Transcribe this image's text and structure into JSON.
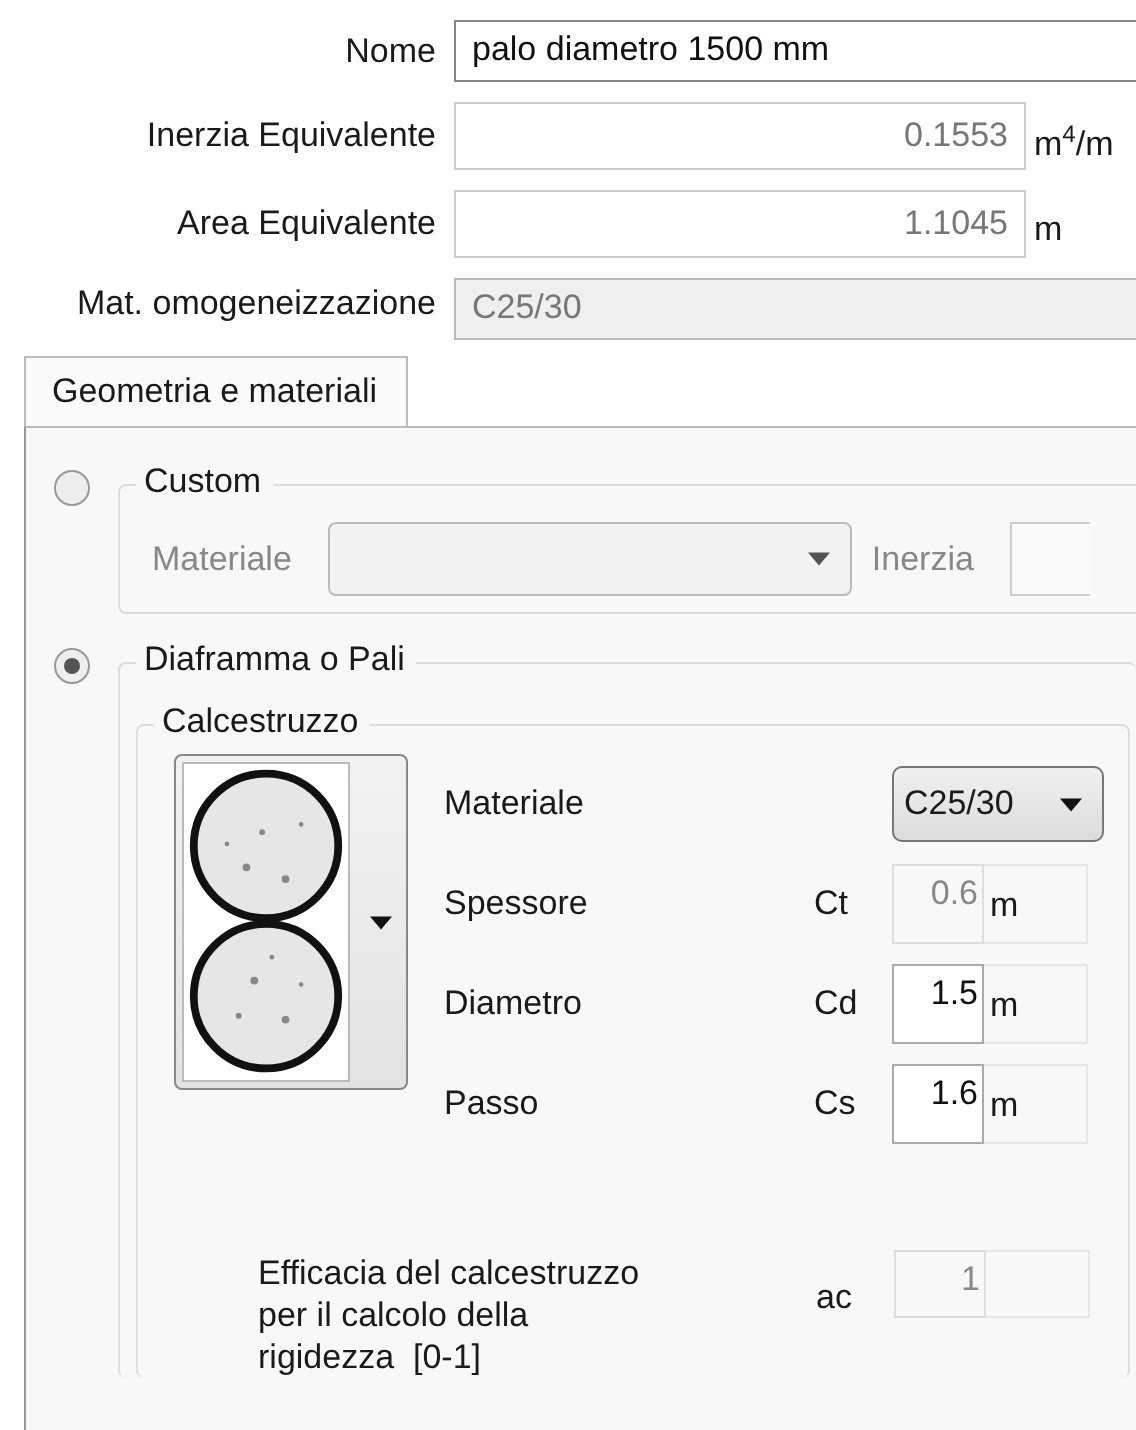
{
  "fields": [
    {
      "label": "Nome",
      "value": "palo diametro 1500 mm",
      "kind": "text",
      "focused": true
    },
    {
      "label": "Inerzia Equivalente",
      "value": "0.1553",
      "unit": "m$^{4}$/m",
      "kind": "number"
    },
    {
      "label": "Area Equivalente",
      "value": "1.1045",
      "unit": "m",
      "kind": "number"
    },
    {
      "label": "Mat. omogeneizzazione",
      "value": "C25/30",
      "kind": "text",
      "disabled": true
    }
  ],
  "tabs": [
    {
      "label": "Geometria e materiali",
      "selected": true
    }
  ],
  "options": [
    {
      "kind": "custom",
      "title": "Custom",
      "selected": false,
      "disabled": true,
      "material_label": "Materiale",
      "inertia_label": "Inerzia"
    },
    {
      "kind": "section",
      "title": "Diaframma o Pali",
      "selected": true,
      "group": {
        "title": "Calcestruzzo",
        "material": {
          "label": "Materiale",
          "value": "C25/30"
        },
        "params": [
          {
            "label": "Spessore",
            "symbol": "Ct",
            "value": "0.6",
            "unit": "m",
            "disabled": true
          },
          {
            "label": "Diametro",
            "symbol": "Cd",
            "value": "1.5",
            "unit": "m",
            "disabled": false
          },
          {
            "label": "Passo",
            "symbol": "Cs",
            "value": "1.6",
            "unit": "m",
            "disabled": false
          }
        ],
        "efficacy": {
          "label": "Efficacia del calcestruzzo per il calcolo della rigidezza  [0-1]",
          "symbol": "ac",
          "value": "1",
          "disabled": true
        }
      }
    }
  ]
}
